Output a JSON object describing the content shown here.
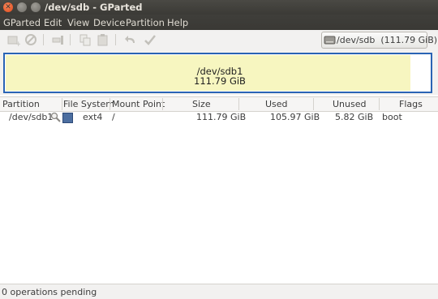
{
  "window": {
    "title": "/dev/sdb - GParted"
  },
  "menu": [
    "GParted",
    "Edit",
    "View",
    "Device",
    "Partition",
    "Help"
  ],
  "device_selector": {
    "value": "/dev/sdb  (111.79 GiB)"
  },
  "graph": {
    "name": "/dev/sdb1",
    "size": "111.79 GiB",
    "used_fraction": 0.95
  },
  "table": {
    "headers": [
      "Partition",
      "File System",
      "Mount Point",
      "Size",
      "Used",
      "Unused",
      "Flags"
    ],
    "rows": [
      {
        "partition": "/dev/sdb1",
        "filesystem": "ext4",
        "mount": "/",
        "size": "111.79 GiB",
        "used": "105.97 GiB",
        "unused": "5.82 GiB",
        "flags": "boot",
        "fs_color": "#4c6ea0"
      }
    ]
  },
  "status": {
    "text": "0 operations pending"
  }
}
